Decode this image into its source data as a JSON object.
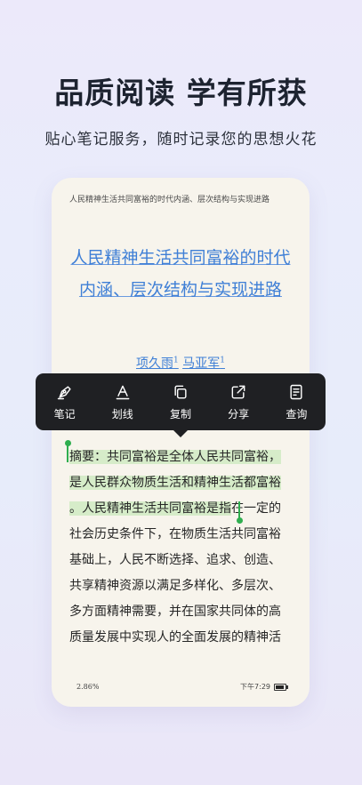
{
  "promo": {
    "headline": "品质阅读 学有所获",
    "subline": "贴心笔记服务，随时记录您的思想火花"
  },
  "reader": {
    "running_title": "人民精神生活共同富裕的时代内涵、层次结构与实现进路",
    "title_line1": "人民精神生活共同富裕的时代",
    "title_line2": "内涵、层次结构与实现进路",
    "author1": "项久雨",
    "author1_sup": "1",
    "author2": "马亚军",
    "author2_sup": "1",
    "body_lines": [
      "摘要：共同富裕是全体人民共同富裕，",
      "是人民群众物质生活和精神生活都富裕",
      "。人民精神生活共同富裕是指",
      "在一定的",
      "社会历史条件下，在物质生活共同富裕",
      "基础上，人民不断选择、追求、创造、",
      "共享精神资源以满足多样化、多层次、",
      "多方面精神需要，并在国家共同体的高",
      "质量发展中实现人的全面发展的精神活"
    ],
    "progress": "2.86%",
    "time": "下午7:29"
  },
  "toolbar": {
    "note": "笔记",
    "underline": "划线",
    "copy": "复制",
    "share": "分享",
    "lookup": "查询"
  },
  "icons": [
    "pen-note-icon",
    "underline-a-icon",
    "copy-icon",
    "share-icon",
    "lookup-icon",
    "battery-icon"
  ],
  "colors": {
    "highlight": "#d6ecc9",
    "cursor": "#2fae4f",
    "title_link": "#3f7fd6",
    "toolbar_bg": "#1f2023"
  }
}
